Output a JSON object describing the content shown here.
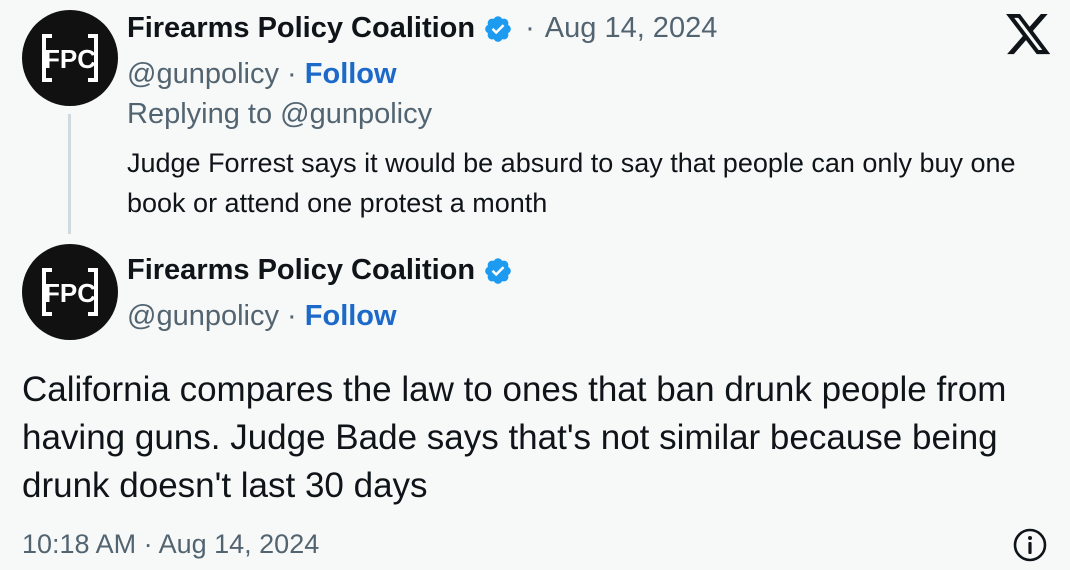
{
  "reply_tweet": {
    "author_name": "Firearms Policy Coalition",
    "separator": "·",
    "date": "Aug 14, 2024",
    "handle": "@gunpolicy",
    "handle_separator": "·",
    "follow_label": "Follow",
    "replying_to": "Replying to @gunpolicy",
    "text": "Judge Forrest says it would be absurd to say that people can only buy one book or attend one protest a month"
  },
  "main_tweet": {
    "author_name": "Firearms Policy Coalition",
    "handle": "@gunpolicy",
    "handle_separator": "·",
    "follow_label": "Follow",
    "text": "California compares the law to ones that ban drunk people from having guns. Judge Bade says that's not similar because being drunk doesn't last 30 days",
    "timestamp": "10:18 AM · Aug 14, 2024"
  },
  "avatar": {
    "logo_text": "FPC"
  },
  "icons": {
    "brand": "x-logo-icon",
    "verified": "verified-badge-icon",
    "info": "info-icon"
  },
  "colors": {
    "background": "#f7f9f9",
    "text": "#0f1419",
    "secondary_text": "#536471",
    "follow": "#1d69c9",
    "verified": "#1d9bf0",
    "thread_line": "#cfd9de"
  }
}
